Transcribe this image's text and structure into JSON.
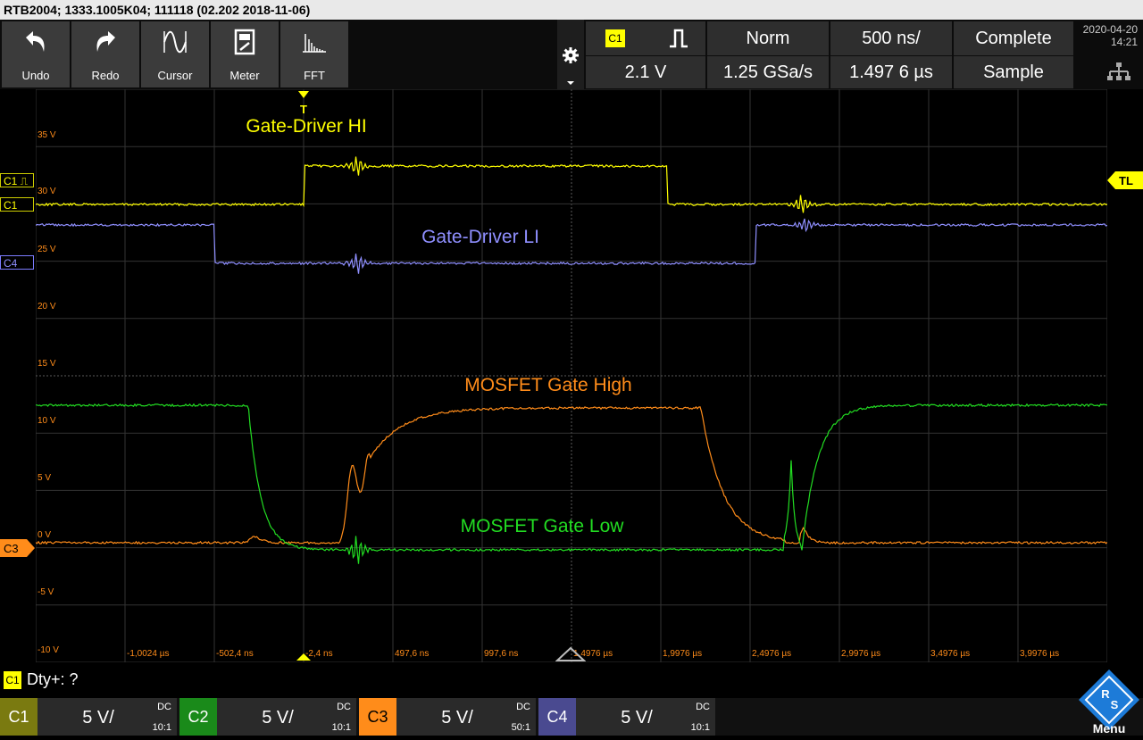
{
  "title": "RTB2004; 1333.1005K04; 111118 (02.202 2018-11-06)",
  "toolbar": {
    "buttons": [
      {
        "label": "Undo",
        "icon": "undo-icon"
      },
      {
        "label": "Redo",
        "icon": "redo-icon"
      },
      {
        "label": "Cursor",
        "icon": "cursor-icon"
      },
      {
        "label": "Meter",
        "icon": "meter-icon"
      },
      {
        "label": "FFT",
        "icon": "fft-icon"
      }
    ]
  },
  "trigger": {
    "source": "C1",
    "mode": "Norm",
    "level": "2.1 V",
    "edge_icon": "rising-edge-icon"
  },
  "acquisition": {
    "timebase": "500 ns/",
    "sample_rate": "1.25 GSa/s",
    "offset": "1.497 6 µs",
    "status": "Complete",
    "mode": "Sample"
  },
  "datetime": {
    "date": "2020-04-20",
    "time": "14:21"
  },
  "plot": {
    "y_labels": [
      "35 V",
      "30 V",
      "25 V",
      "20 V",
      "15 V",
      "10 V",
      "5 V",
      "0 V",
      "-5 V",
      "-10 V"
    ],
    "x_labels": [
      "-1,0024 µs",
      "-502,4 ns",
      "-2,4 ns",
      "497,6 ns",
      "997,6 ns",
      "1,4976 µs",
      "1,9976 µs",
      "2,4976 µs",
      "2,9976 µs",
      "3,4976 µs",
      "3,9976 µs"
    ],
    "trigger_marker": "T",
    "trigger_level_tag": "TL",
    "channel_markers": {
      "c1_trig": "C1 ⎍",
      "c1": "C1",
      "c4": "C4",
      "c3": "C3"
    },
    "annotations": [
      "Gate-Driver HI",
      "Gate-Driver LI",
      "MOSFET Gate High",
      "MOSFET Gate Low"
    ]
  },
  "traces": {
    "colors": {
      "c1": "#ffff00",
      "c2": "#22dd22",
      "c3": "#ff8c1a",
      "c4": "#8f8fff"
    }
  },
  "measurement": {
    "badge": "C1",
    "text": "Dty+: ?"
  },
  "channels": [
    {
      "tag": "C1",
      "scale": "5 V/",
      "coupling": "DC",
      "probe": "10:1",
      "color": "#ffff00"
    },
    {
      "tag": "C2",
      "scale": "5 V/",
      "coupling": "DC",
      "probe": "10:1",
      "color": "#22aa22"
    },
    {
      "tag": "C3",
      "scale": "5 V/",
      "coupling": "DC",
      "probe": "50:1",
      "color": "#ff8c1a"
    },
    {
      "tag": "C4",
      "scale": "5 V/",
      "coupling": "DC",
      "probe": "10:1",
      "color": "#7c7cff"
    }
  ],
  "menu_label": "Menu"
}
